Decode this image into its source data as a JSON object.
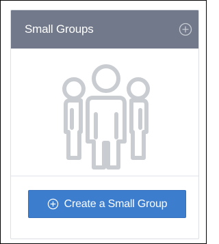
{
  "widget": {
    "title": "Small Groups",
    "add_icon": "plus-circle-icon",
    "illustration_icon": "people-group-icon"
  },
  "create_button": {
    "label": "Create a Small Group",
    "icon": "plus-circle-icon"
  },
  "colors": {
    "header_bg": "#72798a",
    "button_bg": "#3d7dce",
    "illustration": "#c9ccd1",
    "text_on_dark": "#ffffff"
  }
}
